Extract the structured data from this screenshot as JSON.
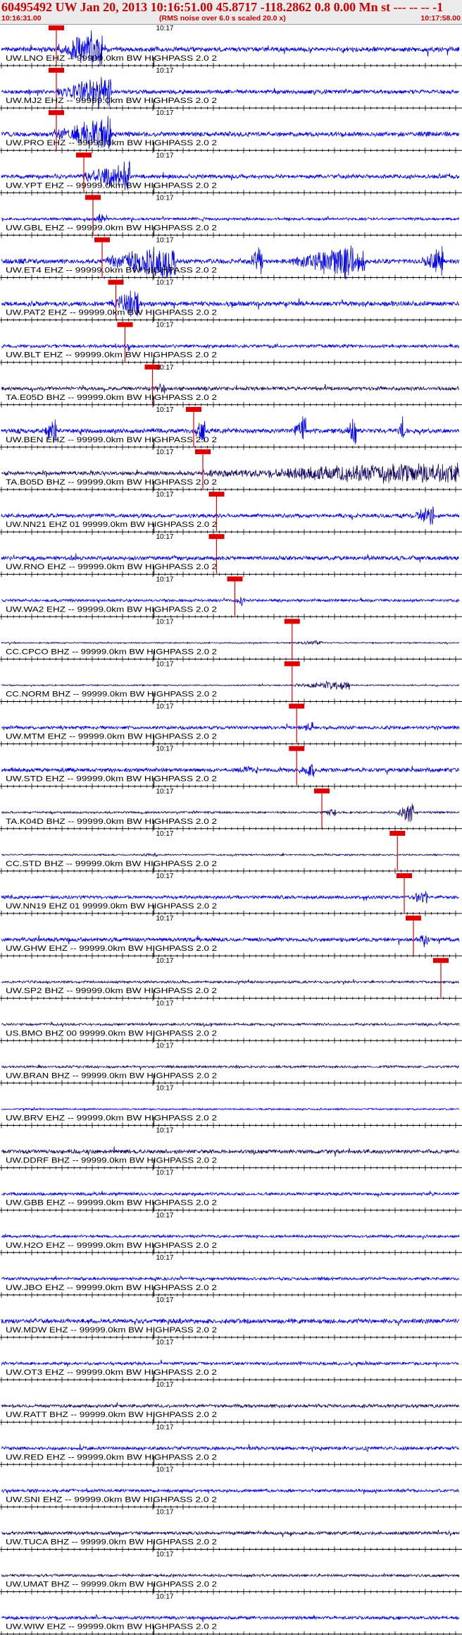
{
  "header": {
    "title": "60495492 UW Jan 20, 2013 10:16:51.00   45.8717 -118.2862  0.8 0.00 Mn st --- -- --   -1",
    "start_time": "10:16:31.00",
    "note": "(RMS noise over 6.0 s scaled 20.0 x)",
    "end_time": "10:17:58.00"
  },
  "tick_label": "10:17",
  "colors": {
    "trace_blue": "#0000ee",
    "trace_navy": "#1a0a66",
    "pick_red": "#dd0000",
    "axis": "#000000",
    "header_bg": "#ebebeb"
  },
  "chart_data": {
    "type": "line",
    "title": "60495492 UW Jan 20, 2013 10:16:51.00   45.8717 -118.2862  0.8 0.00 Mn st --- -- --   -1",
    "x_range": [
      "10:16:31.00",
      "10:17:58.00"
    ],
    "tick_label": "10:17",
    "legend": "none",
    "grid": false,
    "traces": [
      {
        "label": "UW.LNO EHZ -- 99999.0km BW  HIGHPASS  2.0  2",
        "color": "blue",
        "pick": 0.12,
        "amp": 0.35,
        "bursts": [
          [
            0.12,
            0.22,
            2.6
          ]
        ]
      },
      {
        "label": "UW.MJ2 EHZ -- 99999.0km BW  HIGHPASS  2.0  2",
        "color": "blue",
        "pick": 0.12,
        "amp": 0.3,
        "bursts": [
          [
            0.12,
            0.24,
            2.2
          ]
        ]
      },
      {
        "label": "UW.PRO EHZ -- 99999.0km BW  HIGHPASS  2.0  2",
        "color": "blue",
        "pick": 0.12,
        "amp": 0.35,
        "bursts": [
          [
            0.12,
            0.24,
            2.4
          ]
        ]
      },
      {
        "label": "UW.YPT EHZ -- 99999.0km BW  HIGHPASS  2.0  2",
        "color": "blue",
        "pick": 0.18,
        "amp": 0.3,
        "bursts": [
          [
            0.18,
            0.28,
            2.2
          ]
        ]
      },
      {
        "label": "UW.GBL EHZ -- 99999.0km BW  HIGHPASS  2.0  2",
        "color": "blue",
        "pick": 0.2,
        "amp": 0.2,
        "bursts": [
          [
            0.2,
            0.23,
            1.0
          ]
        ]
      },
      {
        "label": "UW.ET4 EHZ -- 99999.0km BW  HIGHPASS  2.0  2",
        "color": "blue",
        "pick": 0.22,
        "amp": 0.35,
        "bursts": [
          [
            0.23,
            0.38,
            2.6
          ],
          [
            0.545,
            0.57,
            2.6
          ],
          [
            0.635,
            0.795,
            2.6
          ],
          [
            0.925,
            0.965,
            2.4
          ]
        ]
      },
      {
        "label": "UW.PAT2 EHZ -- 99999.0km BW  HIGHPASS  2.0  2",
        "color": "blue",
        "pick": 0.25,
        "amp": 0.35,
        "bursts": [
          [
            0.24,
            0.3,
            2.3
          ]
        ]
      },
      {
        "label": "UW.BLT EHZ -- 99999.0km BW  HIGHPASS  2.0  2",
        "color": "blue",
        "pick": 0.27,
        "amp": 0.25,
        "bursts": [
          [
            0.27,
            0.28,
            1.0
          ]
        ]
      },
      {
        "label": "TA.E05D BHZ -- 99999.0km BW  HIGHPASS  2.0  2",
        "color": "navy",
        "pick": 0.33,
        "amp": 0.28,
        "bursts": [
          [
            0.33,
            0.36,
            0.9
          ]
        ]
      },
      {
        "label": "UW.BEN EHZ -- 99999.0km BW  HIGHPASS  2.0  2",
        "color": "blue",
        "pick": 0.42,
        "amp": 0.35,
        "bursts": [
          [
            0.095,
            0.12,
            2.4
          ],
          [
            0.425,
            0.445,
            2.2
          ],
          [
            0.64,
            0.665,
            2.4
          ],
          [
            0.755,
            0.775,
            2.2
          ],
          [
            0.865,
            0.88,
            2.2
          ]
        ]
      },
      {
        "label": "TA.B05D BHZ -- 99999.0km BW  HIGHPASS  2.0  2",
        "color": "navy",
        "pick": 0.44,
        "amp": 0.3,
        "bursts": [
          [
            0.44,
            1.0,
            1.5
          ]
        ]
      },
      {
        "label": "UW.NN21 EHZ 01 99999.0km BW  HIGHPASS  2.0  2",
        "color": "blue",
        "pick": 0.47,
        "amp": 0.3,
        "bursts": [
          [
            0.895,
            0.945,
            1.4
          ]
        ]
      },
      {
        "label": "UW.RNO EHZ -- 99999.0km BW  HIGHPASS  2.0  2",
        "color": "blue",
        "pick": 0.47,
        "amp": 0.3,
        "bursts": []
      },
      {
        "label": "UW.WA2 EHZ -- 99999.0km BW  HIGHPASS  2.0  2",
        "color": "blue",
        "pick": 0.51,
        "amp": 0.2,
        "bursts": [
          [
            0.51,
            0.53,
            0.8
          ]
        ]
      },
      {
        "label": "CC.CPCO BHZ -- 99999.0km BW  HIGHPASS  2.0  2",
        "color": "navy",
        "pick": 0.635,
        "amp": 0.1,
        "bursts": [
          [
            0.64,
            0.7,
            0.4
          ]
        ]
      },
      {
        "label": "CC.NORM BHZ -- 99999.0km BW  HIGHPASS  2.0  2",
        "color": "navy",
        "pick": 0.635,
        "amp": 0.1,
        "bursts": [
          [
            0.64,
            0.76,
            0.7
          ]
        ]
      },
      {
        "label": "UW.MTM EHZ -- 99999.0km BW  HIGHPASS  2.0  2",
        "color": "blue",
        "pick": 0.645,
        "amp": 0.25,
        "bursts": [
          [
            0.65,
            0.68,
            0.9
          ]
        ]
      },
      {
        "label": "UW.STD EHZ -- 99999.0km BW  HIGHPASS  2.0  2",
        "color": "blue",
        "pick": 0.645,
        "amp": 0.3,
        "bursts": [
          [
            0.48,
            0.56,
            0.6
          ],
          [
            0.655,
            0.685,
            1.3
          ]
        ]
      },
      {
        "label": "TA.K04D BHZ -- 99999.0km BW  HIGHPASS  2.0  2",
        "color": "navy",
        "pick": 0.7,
        "amp": 0.15,
        "bursts": [
          [
            0.7,
            0.73,
            0.6
          ],
          [
            0.865,
            0.9,
            1.6
          ]
        ]
      },
      {
        "label": "CC.STD BHZ -- 99999.0km BW  HIGHPASS  2.0  2",
        "color": "navy",
        "pick": 0.865,
        "amp": 0.12,
        "bursts": [
          [
            0.29,
            0.34,
            0.3
          ]
        ]
      },
      {
        "label": "UW.NN19 EHZ 01 99999.0km BW  HIGHPASS  2.0  2",
        "color": "blue",
        "pick": 0.88,
        "amp": 0.25,
        "bursts": [
          [
            0.89,
            0.93,
            1.0
          ]
        ]
      },
      {
        "label": "UW.GHW EHZ -- 99999.0km BW  HIGHPASS  2.0  2",
        "color": "blue",
        "pick": 0.9,
        "amp": 0.3,
        "bursts": [
          [
            0.91,
            0.93,
            1.2
          ]
        ]
      },
      {
        "label": "UW.SP2 BHZ -- 99999.0km BW  HIGHPASS  2.0  2",
        "color": "navy",
        "pick": 0.96,
        "amp": 0.18,
        "bursts": []
      },
      {
        "label": "US.BMO BHZ 00 99999.0km BW  HIGHPASS  2.0  2",
        "color": "navy",
        "pick": null,
        "amp": 0.18,
        "bursts": []
      },
      {
        "label": "UW.BRAN BHZ -- 99999.0km BW  HIGHPASS  2.0  2",
        "color": "navy",
        "pick": null,
        "amp": 0.18,
        "bursts": []
      },
      {
        "label": "UW.BRV EHZ -- 99999.0km BW  HIGHPASS  2.0  2",
        "color": "blue",
        "pick": null,
        "amp": 0.12,
        "bursts": []
      },
      {
        "label": "UW.DDRF BHZ -- 99999.0km BW  HIGHPASS  2.0  2",
        "color": "navy",
        "pick": null,
        "amp": 0.3,
        "bursts": []
      },
      {
        "label": "UW.GBB EHZ -- 99999.0km BW  HIGHPASS  2.0  2",
        "color": "blue",
        "pick": null,
        "amp": 0.22,
        "bursts": []
      },
      {
        "label": "UW.H2O EHZ -- 99999.0km BW  HIGHPASS  2.0  2",
        "color": "blue",
        "pick": null,
        "amp": 0.2,
        "bursts": []
      },
      {
        "label": "UW.JBO EHZ -- 99999.0km BW  HIGHPASS  2.0  2",
        "color": "blue",
        "pick": null,
        "amp": 0.22,
        "bursts": []
      },
      {
        "label": "UW.MDW EHZ -- 99999.0km BW  HIGHPASS  2.0  2",
        "color": "blue",
        "pick": null,
        "amp": 0.35,
        "bursts": []
      },
      {
        "label": "UW.OT3 EHZ -- 99999.0km BW  HIGHPASS  2.0  2",
        "color": "blue",
        "pick": null,
        "amp": 0.22,
        "bursts": []
      },
      {
        "label": "UW.RATT BHZ -- 99999.0km BW  HIGHPASS  2.0  2",
        "color": "navy",
        "pick": null,
        "amp": 0.25,
        "bursts": []
      },
      {
        "label": "UW.RED EHZ -- 99999.0km BW  HIGHPASS  2.0  2",
        "color": "blue",
        "pick": null,
        "amp": 0.25,
        "bursts": [
          [
            0.79,
            0.8,
            0.9
          ]
        ]
      },
      {
        "label": "UW.SNI EHZ -- 99999.0km BW  HIGHPASS  2.0  2",
        "color": "blue",
        "pick": null,
        "amp": 0.22,
        "bursts": []
      },
      {
        "label": "UW.TUCA BHZ -- 99999.0km BW  HIGHPASS  2.0  2",
        "color": "navy",
        "pick": null,
        "amp": 0.25,
        "bursts": []
      },
      {
        "label": "UW.UMAT BHZ -- 99999.0km BW  HIGHPASS  2.0  2",
        "color": "navy",
        "pick": null,
        "amp": 0.2,
        "bursts": []
      },
      {
        "label": "UW.WIW EHZ -- 99999.0km BW  HIGHPASS  2.0  2",
        "color": "blue",
        "pick": null,
        "amp": 0.25,
        "bursts": [
          [
            0.2,
            0.21,
            0.7
          ]
        ]
      }
    ]
  }
}
